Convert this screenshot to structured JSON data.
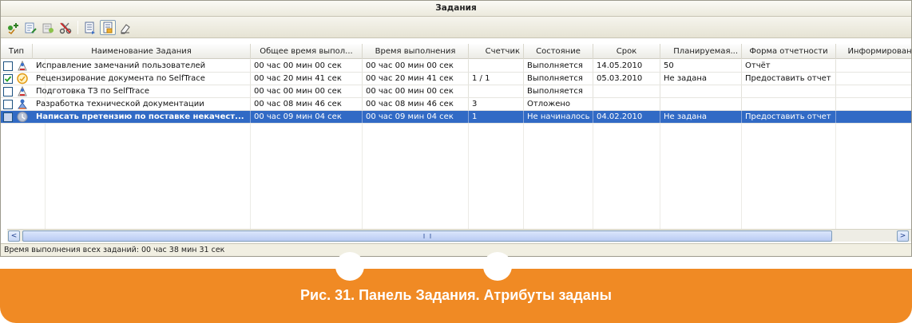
{
  "panel": {
    "title": "Задания"
  },
  "toolbar": {
    "icons": [
      "add-task-icon",
      "edit-task-icon",
      "delete-task-icon",
      "cut-task-icon",
      "report-icon",
      "export-icon",
      "clear-icon"
    ]
  },
  "grid": {
    "columns": [
      "Тип",
      "Наименование Задания",
      "Общее время выпол...",
      "Время выполнения",
      "Счетчик",
      "Состояние",
      "Срок",
      "Планируемая...",
      "Форма отчетности",
      "Информирован"
    ],
    "rows": [
      {
        "checked": false,
        "name": "Исправление замечаний пользователей",
        "total_time": "00 час 00 мин 00 сек",
        "exec_time": "00 час 00 мин 00 сек",
        "counter": "",
        "state": "Выполняется",
        "deadline": "14.05.2010",
        "planned": "50",
        "report_form": "Отчёт",
        "informed": ""
      },
      {
        "checked": true,
        "name": "Рецензирование документа по SelfTrace",
        "total_time": "00 час 20 мин 41 сек",
        "exec_time": "00 час 20 мин 41 сек",
        "counter": "1 / 1",
        "state": "Выполняется",
        "deadline": "05.03.2010",
        "planned": "Не задана",
        "report_form": "Предоставить отчет",
        "informed": ""
      },
      {
        "checked": false,
        "name": "Подготовка ТЗ по SelfTrace",
        "total_time": "00 час 00 мин 00 сек",
        "exec_time": "00 час 00 мин 00 сек",
        "counter": "",
        "state": "Выполняется",
        "deadline": "",
        "planned": "",
        "report_form": "",
        "informed": ""
      },
      {
        "checked": false,
        "name": "Разработка технической документации",
        "total_time": "00 час 08 мин 46 сек",
        "exec_time": "00 час 08 мин 46 сек",
        "counter": "3",
        "state": "Отложено",
        "deadline": "",
        "planned": "",
        "report_form": "",
        "informed": ""
      },
      {
        "checked": false,
        "name": "Написать претензию по поставке некачест...",
        "total_time": "00 час 09 мин 04 сек",
        "exec_time": "00 час 09 мин 04 сек",
        "counter": "1",
        "state": "Не начиналось",
        "deadline": "04.02.2010",
        "planned": "Не задана",
        "report_form": "Предоставить отчет",
        "informed": ""
      }
    ],
    "selected_row": 4
  },
  "scroll": {
    "left_arrow": "<",
    "right_arrow": ">"
  },
  "status": {
    "text": "Время выполнения всех заданий: 00 час 38 мин 31 сек"
  },
  "caption": {
    "text": "Рис. 31. Панель Задания. Атрибуты заданы"
  },
  "colors": {
    "accent": "#f08a24",
    "selection": "#316ac5"
  }
}
